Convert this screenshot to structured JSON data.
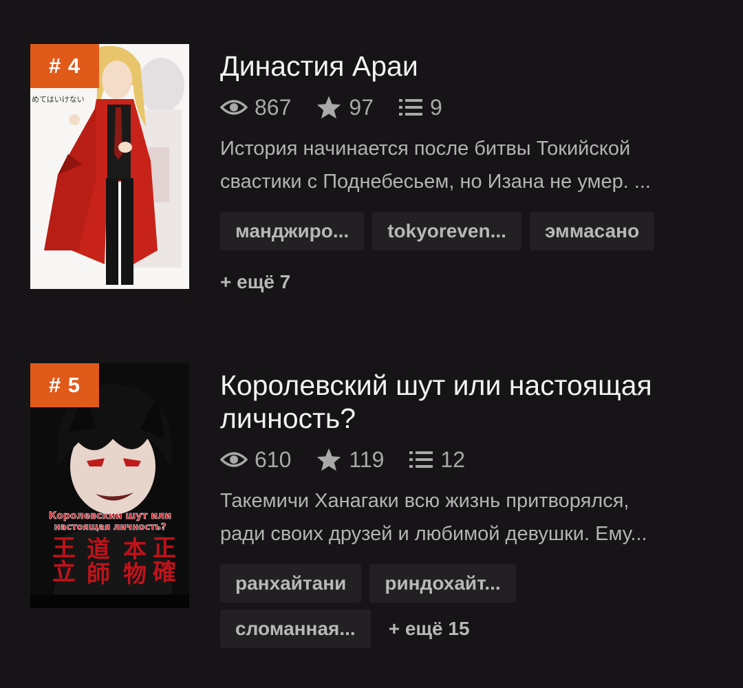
{
  "stories": [
    {
      "rank": "# 4",
      "title": "Династия Араи",
      "stats": {
        "views": "867",
        "stars": "97",
        "chapters": "9"
      },
      "description": [
        "История начинается после битвы Токийской",
        "свастики с Поднебесьем, но Изана не умер. ..."
      ],
      "tags": [
        "манджиро...",
        "tokyoreven...",
        "эммасано"
      ],
      "more": "+ ещё 7",
      "cover_text": "めてはいけない",
      "colors": {
        "cover_bg": "#f7f6f4",
        "coat": "#c8231a",
        "hair": "#e8c46a"
      }
    },
    {
      "rank": "# 5",
      "title_lines": [
        "Королевский шут или настоящая",
        "личность?"
      ],
      "stats": {
        "views": "610",
        "stars": "119",
        "chapters": "12"
      },
      "description": [
        "Такемичи Ханагаки всю жизнь притворялся,",
        "ради своих друзей и любимой девушки. Ему..."
      ],
      "tags": [
        "ранхайтани",
        "риндохайт...",
        "сломанная..."
      ],
      "more": "+ ещё 15",
      "cover_text": [
        "Королевский шут или",
        "настоящая личность?"
      ],
      "cover_kanji": [
        "王",
        "道",
        "本",
        "正",
        "立",
        "師",
        "物",
        "確"
      ],
      "colors": {
        "cover_bg": "#0d0c0d",
        "text_red": "#c0121a",
        "eyes": "#c01a1a"
      }
    }
  ],
  "theme": {
    "accent": "#e05a1a",
    "background": "#161416",
    "tag_bg": "#222022"
  },
  "icons": {
    "views": "eye-icon",
    "stars": "star-icon",
    "chapters": "list-icon"
  }
}
